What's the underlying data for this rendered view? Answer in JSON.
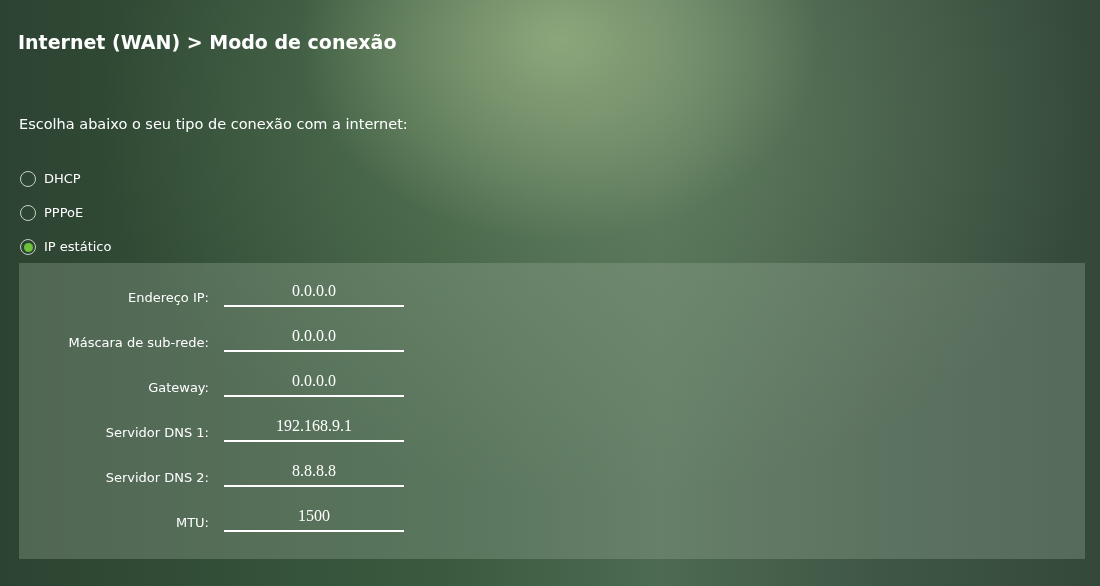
{
  "title": "Internet (WAN) > Modo de conexão",
  "prompt": "Escolha abaixo o seu tipo de conexão com a internet:",
  "connection_types": [
    {
      "label": "DHCP",
      "selected": false
    },
    {
      "label": "PPPoE",
      "selected": false
    },
    {
      "label": "IP estático",
      "selected": true
    }
  ],
  "static_ip_fields": [
    {
      "label": "Endereço IP:",
      "value": "0.0.0.0"
    },
    {
      "label": "Máscara de sub-rede:",
      "value": "0.0.0.0"
    },
    {
      "label": "Gateway:",
      "value": "0.0.0.0"
    },
    {
      "label": "Servidor DNS 1:",
      "value": "192.168.9.1"
    },
    {
      "label": "Servidor DNS 2:",
      "value": "8.8.8.8"
    },
    {
      "label": "MTU:",
      "value": "1500"
    }
  ]
}
